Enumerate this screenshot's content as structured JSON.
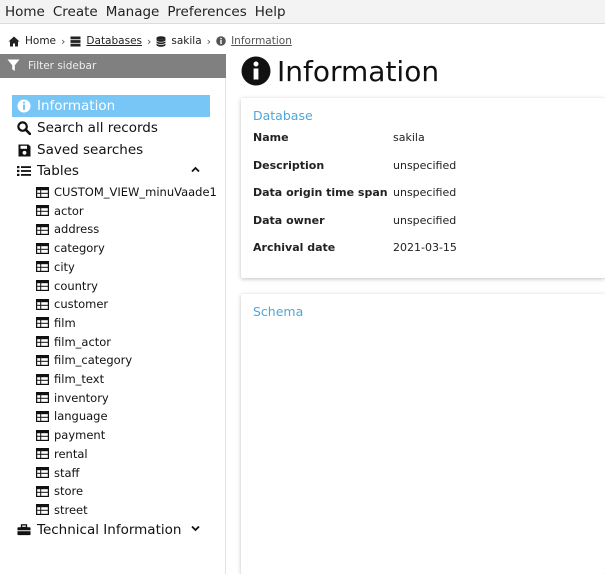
{
  "menu": [
    "Home",
    "Create",
    "Manage",
    "Preferences",
    "Help"
  ],
  "breadcrumb": {
    "home": "Home",
    "databases": "Databases",
    "db": "sakila",
    "current": "Information"
  },
  "sidebar": {
    "filter_placeholder": "Filter sidebar",
    "nav": {
      "information": "Information",
      "search_all": "Search all records",
      "saved_searches": "Saved searches",
      "tables": "Tables",
      "technical_information": "Technical Information"
    },
    "tables": [
      "CUSTOM_VIEW_minuVaade1",
      "actor",
      "address",
      "category",
      "city",
      "country",
      "customer",
      "film",
      "film_actor",
      "film_category",
      "film_text",
      "inventory",
      "language",
      "payment",
      "rental",
      "staff",
      "store",
      "street"
    ]
  },
  "page_title": "Information",
  "database_card": {
    "title": "Database",
    "rows": [
      {
        "key": "Name",
        "value": "sakila"
      },
      {
        "key": "Description",
        "value": "unspecified"
      },
      {
        "key": "Data origin time span",
        "value": "unspecified"
      },
      {
        "key": "Data owner",
        "value": "unspecified"
      },
      {
        "key": "Archival date",
        "value": "2021-03-15"
      }
    ]
  },
  "schema_card": {
    "title": "Schema"
  },
  "colors": {
    "active": "#78c6f5",
    "card_title": "#4fa6d9",
    "filter_bg": "#808080"
  }
}
